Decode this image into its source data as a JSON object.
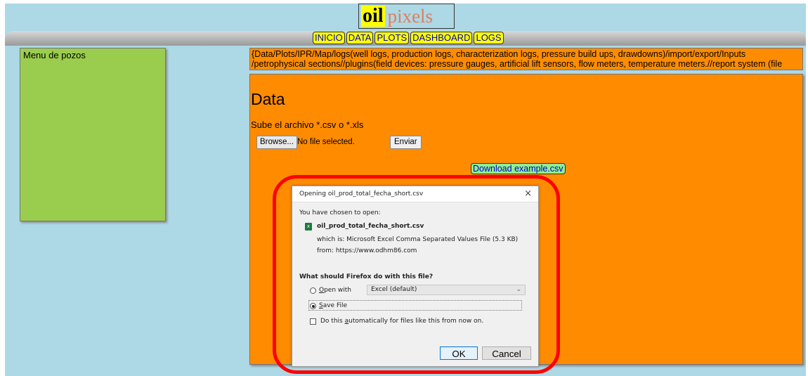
{
  "logo": {
    "oil": "oil",
    "pixels": "pixels"
  },
  "nav": [
    "INICIO",
    "DATA",
    "PLOTS",
    "DASHBOARD",
    "LOGS"
  ],
  "sidebar": {
    "title": "Menu de pozos"
  },
  "infobar": {
    "text": "{Data/Plots/IPR/Map/logs(well logs, production logs, characterization logs, pressure build ups, drawdowns)/import/export/Inputs /petrophysical sections//plugins(field devices: pressure gauges, artificial lift sensors, flow meters, temperature meters.//report system (file creation)}"
  },
  "main": {
    "heading": "Data",
    "upload_label": "Sube el archivo *.csv o *.xls",
    "browse_label": "Browse...",
    "no_file": "No file selected.",
    "submit_label": "Enviar",
    "download_label": "Download example.csv"
  },
  "dialog": {
    "title": "Opening oil_prod_total_fecha_short.csv",
    "close": "×",
    "chosen": "You have chosen to open:",
    "file_name": "oil_prod_total_fecha_short.csv",
    "which": "which is: Microsoft Excel Comma Separated Values File (5.3 KB)",
    "from": "from: https://www.odhm86.com",
    "question": "What should Firefox do with this file?",
    "open_with_label": "Open with",
    "open_with_app": "Excel (default)",
    "save_label": "Save File",
    "auto_label": "Do this automatically for files like this from now on.",
    "ok_label": "OK",
    "cancel_label": "Cancel",
    "selected_action": "save"
  },
  "colors": {
    "background": "#add8e6",
    "sidebar": "#9acd4d",
    "panel": "#ff8c00",
    "highlight": "#ff0000"
  }
}
